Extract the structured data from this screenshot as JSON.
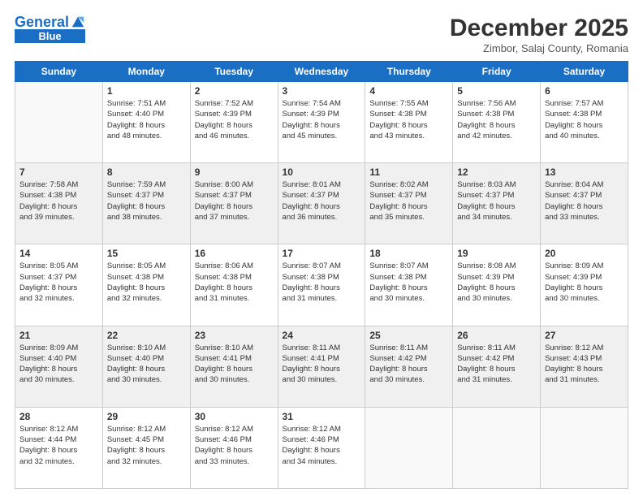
{
  "header": {
    "logo_line1": "General",
    "logo_line2": "Blue",
    "month": "December 2025",
    "location": "Zimbor, Salaj County, Romania"
  },
  "days_of_week": [
    "Sunday",
    "Monday",
    "Tuesday",
    "Wednesday",
    "Thursday",
    "Friday",
    "Saturday"
  ],
  "weeks": [
    [
      {
        "num": "",
        "info": ""
      },
      {
        "num": "1",
        "info": "Sunrise: 7:51 AM\nSunset: 4:40 PM\nDaylight: 8 hours\nand 48 minutes."
      },
      {
        "num": "2",
        "info": "Sunrise: 7:52 AM\nSunset: 4:39 PM\nDaylight: 8 hours\nand 46 minutes."
      },
      {
        "num": "3",
        "info": "Sunrise: 7:54 AM\nSunset: 4:39 PM\nDaylight: 8 hours\nand 45 minutes."
      },
      {
        "num": "4",
        "info": "Sunrise: 7:55 AM\nSunset: 4:38 PM\nDaylight: 8 hours\nand 43 minutes."
      },
      {
        "num": "5",
        "info": "Sunrise: 7:56 AM\nSunset: 4:38 PM\nDaylight: 8 hours\nand 42 minutes."
      },
      {
        "num": "6",
        "info": "Sunrise: 7:57 AM\nSunset: 4:38 PM\nDaylight: 8 hours\nand 40 minutes."
      }
    ],
    [
      {
        "num": "7",
        "info": "Sunrise: 7:58 AM\nSunset: 4:38 PM\nDaylight: 8 hours\nand 39 minutes."
      },
      {
        "num": "8",
        "info": "Sunrise: 7:59 AM\nSunset: 4:37 PM\nDaylight: 8 hours\nand 38 minutes."
      },
      {
        "num": "9",
        "info": "Sunrise: 8:00 AM\nSunset: 4:37 PM\nDaylight: 8 hours\nand 37 minutes."
      },
      {
        "num": "10",
        "info": "Sunrise: 8:01 AM\nSunset: 4:37 PM\nDaylight: 8 hours\nand 36 minutes."
      },
      {
        "num": "11",
        "info": "Sunrise: 8:02 AM\nSunset: 4:37 PM\nDaylight: 8 hours\nand 35 minutes."
      },
      {
        "num": "12",
        "info": "Sunrise: 8:03 AM\nSunset: 4:37 PM\nDaylight: 8 hours\nand 34 minutes."
      },
      {
        "num": "13",
        "info": "Sunrise: 8:04 AM\nSunset: 4:37 PM\nDaylight: 8 hours\nand 33 minutes."
      }
    ],
    [
      {
        "num": "14",
        "info": "Sunrise: 8:05 AM\nSunset: 4:37 PM\nDaylight: 8 hours\nand 32 minutes."
      },
      {
        "num": "15",
        "info": "Sunrise: 8:05 AM\nSunset: 4:38 PM\nDaylight: 8 hours\nand 32 minutes."
      },
      {
        "num": "16",
        "info": "Sunrise: 8:06 AM\nSunset: 4:38 PM\nDaylight: 8 hours\nand 31 minutes."
      },
      {
        "num": "17",
        "info": "Sunrise: 8:07 AM\nSunset: 4:38 PM\nDaylight: 8 hours\nand 31 minutes."
      },
      {
        "num": "18",
        "info": "Sunrise: 8:07 AM\nSunset: 4:38 PM\nDaylight: 8 hours\nand 30 minutes."
      },
      {
        "num": "19",
        "info": "Sunrise: 8:08 AM\nSunset: 4:39 PM\nDaylight: 8 hours\nand 30 minutes."
      },
      {
        "num": "20",
        "info": "Sunrise: 8:09 AM\nSunset: 4:39 PM\nDaylight: 8 hours\nand 30 minutes."
      }
    ],
    [
      {
        "num": "21",
        "info": "Sunrise: 8:09 AM\nSunset: 4:40 PM\nDaylight: 8 hours\nand 30 minutes."
      },
      {
        "num": "22",
        "info": "Sunrise: 8:10 AM\nSunset: 4:40 PM\nDaylight: 8 hours\nand 30 minutes."
      },
      {
        "num": "23",
        "info": "Sunrise: 8:10 AM\nSunset: 4:41 PM\nDaylight: 8 hours\nand 30 minutes."
      },
      {
        "num": "24",
        "info": "Sunrise: 8:11 AM\nSunset: 4:41 PM\nDaylight: 8 hours\nand 30 minutes."
      },
      {
        "num": "25",
        "info": "Sunrise: 8:11 AM\nSunset: 4:42 PM\nDaylight: 8 hours\nand 30 minutes."
      },
      {
        "num": "26",
        "info": "Sunrise: 8:11 AM\nSunset: 4:42 PM\nDaylight: 8 hours\nand 31 minutes."
      },
      {
        "num": "27",
        "info": "Sunrise: 8:12 AM\nSunset: 4:43 PM\nDaylight: 8 hours\nand 31 minutes."
      }
    ],
    [
      {
        "num": "28",
        "info": "Sunrise: 8:12 AM\nSunset: 4:44 PM\nDaylight: 8 hours\nand 32 minutes."
      },
      {
        "num": "29",
        "info": "Sunrise: 8:12 AM\nSunset: 4:45 PM\nDaylight: 8 hours\nand 32 minutes."
      },
      {
        "num": "30",
        "info": "Sunrise: 8:12 AM\nSunset: 4:46 PM\nDaylight: 8 hours\nand 33 minutes."
      },
      {
        "num": "31",
        "info": "Sunrise: 8:12 AM\nSunset: 4:46 PM\nDaylight: 8 hours\nand 34 minutes."
      },
      {
        "num": "",
        "info": ""
      },
      {
        "num": "",
        "info": ""
      },
      {
        "num": "",
        "info": ""
      }
    ]
  ]
}
